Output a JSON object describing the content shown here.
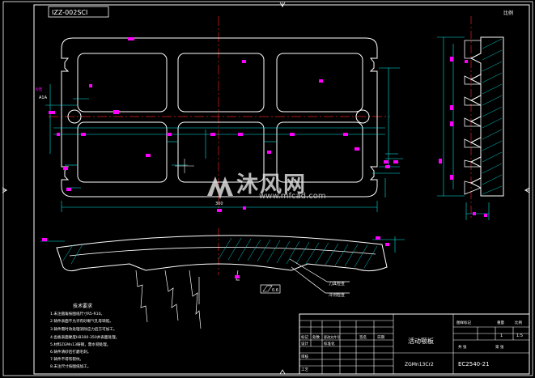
{
  "drawing": {
    "code_box": "IZZ-002SCI",
    "scale_note": "比例",
    "width_dim": "300",
    "left_mark_1": "6倍",
    "left_mark_2": "A1A",
    "right_leader_1": "刀具检查",
    "right_leader_2": "冷剂检查",
    "surface_tag": "0.6"
  },
  "notes": {
    "title": "技术要求",
    "items": [
      "1.未注圆角按图纸尺寸R5-R10。",
      "2.铸件表面不允许有砂眼气孔等缺陷。",
      "3.铸件需时效处理消除应力后方可加工。",
      "4.齿板表面硬度HB300-350并表面处理。",
      "5.材料ZGMn13铸钢，需水韧处理。",
      "6.铸件清砂后打磨毛刺。",
      "7.铸件不得有裂纹。",
      "8.未注尺寸按图纸加工。"
    ]
  },
  "title_block": {
    "part_name": "活动颚板",
    "material": "ZGMn13Cr2",
    "drawing_no": "EC2540-21",
    "scale_label": "比例",
    "scale": "1:5",
    "count_label": "件数",
    "count": "1",
    "sheet_total": "共 张",
    "sheet_no": "第 张",
    "stage_label": "图样标记",
    "weight_label": "重量",
    "standardize": "标准化",
    "process": "工艺",
    "approve": "审核",
    "design": "设计",
    "date": "日期",
    "sign": "签名",
    "mark": "标记",
    "zone": "处数",
    "file_no": "更改文件号"
  },
  "watermark": {
    "text": "沐风网",
    "url": "www.mfcad.com"
  },
  "colors": {
    "background": "#000000",
    "frame": "#ffffff",
    "dimension": "#00e5e5",
    "centerline": "#e02020",
    "hatch": "#00d0d0",
    "text_magenta": "#ff00ff"
  }
}
